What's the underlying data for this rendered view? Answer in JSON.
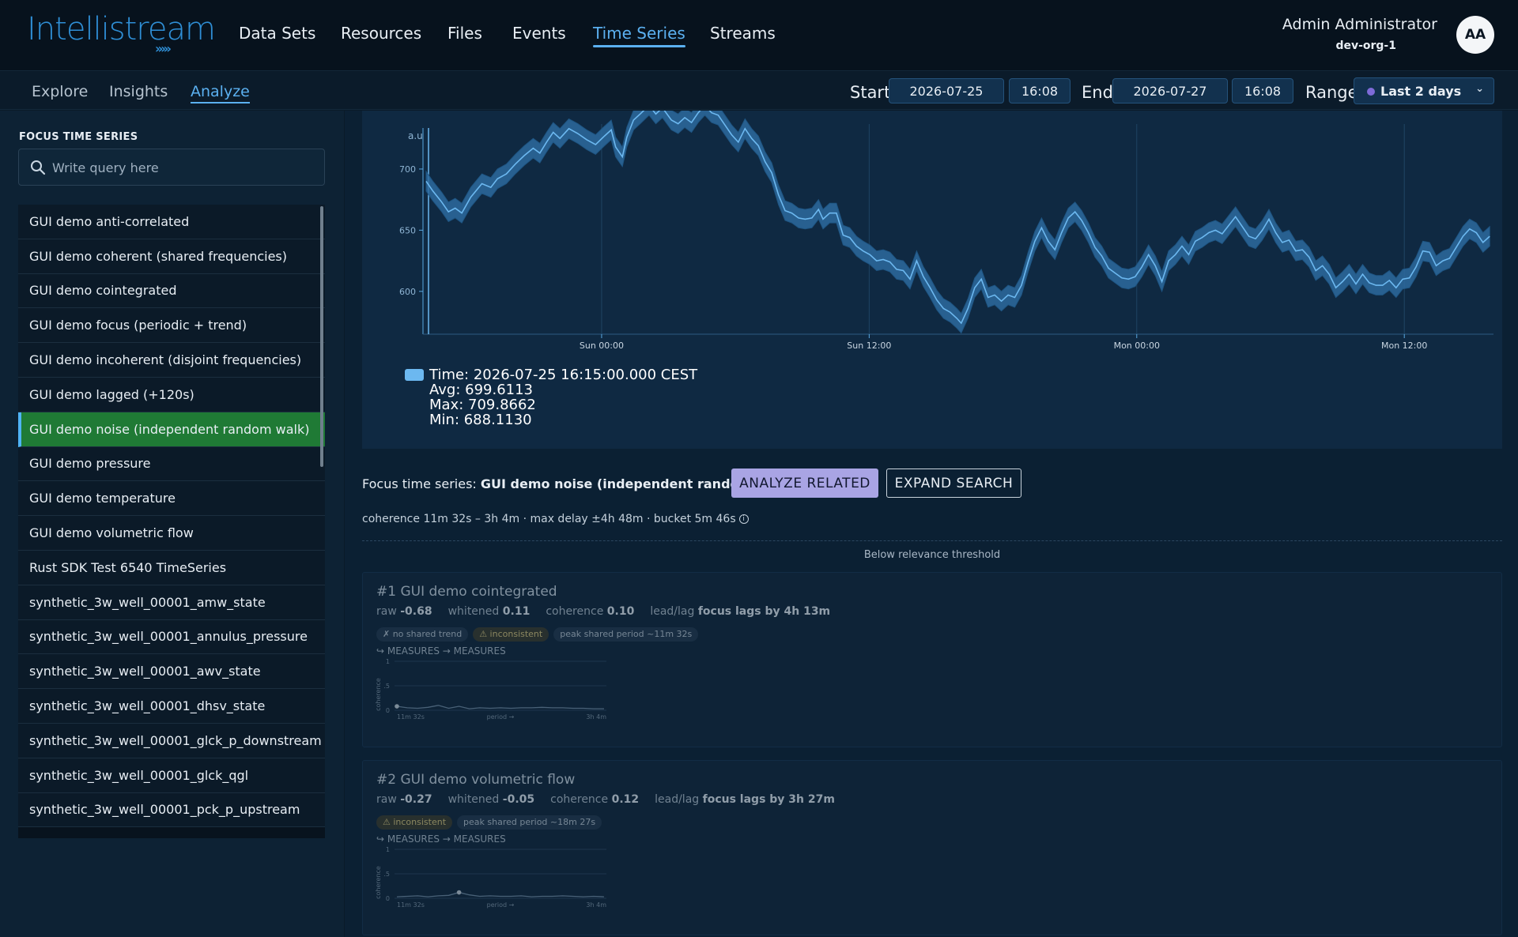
{
  "header": {
    "logo_text": "Intellistream",
    "nav": [
      {
        "label": "Data Sets",
        "active": false
      },
      {
        "label": "Resources",
        "active": false
      },
      {
        "label": "Files",
        "active": false
      },
      {
        "label": "Events",
        "active": false
      },
      {
        "label": "Time Series",
        "active": true
      },
      {
        "label": "Streams",
        "active": false
      }
    ],
    "user_name": "Admin Administrator",
    "user_org": "dev-org-1",
    "avatar_initials": "AA"
  },
  "subnav": {
    "tabs": [
      {
        "label": "Explore",
        "active": false
      },
      {
        "label": "Insights",
        "active": false
      },
      {
        "label": "Analyze",
        "active": true
      }
    ],
    "start_label": "Start",
    "start_date": "2026-07-25",
    "start_time": "16:08",
    "end_label": "End",
    "end_date": "2026-07-27",
    "end_time": "16:08",
    "range_label": "Range",
    "range_value": "Last 2 days"
  },
  "sidebar": {
    "title": "FOCUS TIME SERIES",
    "search_placeholder": "Write query here",
    "items": [
      "GUI demo anti-correlated",
      "GUI demo coherent (shared frequencies)",
      "GUI demo cointegrated",
      "GUI demo focus (periodic + trend)",
      "GUI demo incoherent (disjoint frequencies)",
      "GUI demo lagged (+120s)",
      "GUI demo noise (independent random walk)",
      "GUI demo pressure",
      "GUI demo temperature",
      "GUI demo volumetric flow",
      "Rust SDK Test 6540 TimeSeries",
      "synthetic_3w_well_00001_amw_state",
      "synthetic_3w_well_00001_annulus_pressure",
      "synthetic_3w_well_00001_awv_state",
      "synthetic_3w_well_00001_dhsv_state",
      "synthetic_3w_well_00001_glck_p_downstream",
      "synthetic_3w_well_00001_glck_qgl",
      "synthetic_3w_well_00001_pck_p_upstream"
    ],
    "selected_index": 6
  },
  "chart_data": {
    "type": "line",
    "ylabel": "a.u",
    "yticks": [
      600,
      650,
      700
    ],
    "ylim": [
      565,
      740
    ],
    "xlim": [
      0,
      47.87
    ],
    "xticks": [
      {
        "label": "Sun 00:00",
        "x": 7.87
      },
      {
        "label": "Sun 12:00",
        "x": 19.87
      },
      {
        "label": "Mon 00:00",
        "x": 31.87
      },
      {
        "label": "Mon 12:00",
        "x": 43.87
      }
    ],
    "band_halfwidth": 8,
    "series": [
      {
        "values": [
          [
            0.0,
            690
          ],
          [
            0.3,
            682
          ],
          [
            0.7,
            673
          ],
          [
            1.0,
            665
          ],
          [
            1.3,
            668
          ],
          [
            1.6,
            664
          ],
          [
            2.0,
            677
          ],
          [
            2.5,
            688
          ],
          [
            2.9,
            685
          ],
          [
            3.2,
            692
          ],
          [
            3.6,
            696
          ],
          [
            4.0,
            704
          ],
          [
            4.4,
            711
          ],
          [
            4.8,
            717
          ],
          [
            5.1,
            713
          ],
          [
            5.4,
            722
          ],
          [
            5.7,
            730
          ],
          [
            6.0,
            725
          ],
          [
            6.4,
            733
          ],
          [
            6.8,
            729
          ],
          [
            7.2,
            724
          ],
          [
            7.6,
            720
          ],
          [
            8.0,
            727
          ],
          [
            8.3,
            732
          ],
          [
            8.5,
            718
          ],
          [
            8.8,
            710
          ],
          [
            9.0,
            726
          ],
          [
            9.3,
            740
          ],
          [
            9.6,
            745
          ],
          [
            10.0,
            752
          ],
          [
            10.3,
            745
          ],
          [
            10.6,
            750
          ],
          [
            11.0,
            740
          ],
          [
            11.3,
            737
          ],
          [
            11.6,
            742
          ],
          [
            11.9,
            738
          ],
          [
            12.2,
            746
          ],
          [
            12.5,
            752
          ],
          [
            12.8,
            746
          ],
          [
            13.1,
            744
          ],
          [
            13.4,
            736
          ],
          [
            13.7,
            728
          ],
          [
            14.0,
            722
          ],
          [
            14.3,
            733
          ],
          [
            14.6,
            725
          ],
          [
            14.9,
            719
          ],
          [
            15.2,
            706
          ],
          [
            15.5,
            697
          ],
          [
            15.8,
            679
          ],
          [
            16.1,
            666
          ],
          [
            16.4,
            664
          ],
          [
            16.7,
            660
          ],
          [
            17.0,
            659
          ],
          [
            17.3,
            660
          ],
          [
            17.6,
            667
          ],
          [
            17.8,
            659
          ],
          [
            18.1,
            664
          ],
          [
            18.4,
            664
          ],
          [
            18.7,
            646
          ],
          [
            19.0,
            644
          ],
          [
            19.3,
            637
          ],
          [
            19.6,
            633
          ],
          [
            19.9,
            630
          ],
          [
            20.2,
            625
          ],
          [
            20.5,
            626
          ],
          [
            20.8,
            624
          ],
          [
            21.1,
            618
          ],
          [
            21.4,
            617
          ],
          [
            21.7,
            610
          ],
          [
            22.0,
            625
          ],
          [
            22.3,
            612
          ],
          [
            22.6,
            603
          ],
          [
            22.9,
            593
          ],
          [
            23.2,
            586
          ],
          [
            23.5,
            583
          ],
          [
            23.8,
            578
          ],
          [
            24.0,
            574
          ],
          [
            24.3,
            586
          ],
          [
            24.6,
            603
          ],
          [
            24.9,
            610
          ],
          [
            25.2,
            595
          ],
          [
            25.5,
            597
          ],
          [
            25.8,
            592
          ],
          [
            26.1,
            597
          ],
          [
            26.4,
            595
          ],
          [
            26.7,
            605
          ],
          [
            27.0,
            624
          ],
          [
            27.3,
            641
          ],
          [
            27.6,
            652
          ],
          [
            27.9,
            641
          ],
          [
            28.2,
            634
          ],
          [
            28.5,
            648
          ],
          [
            28.8,
            660
          ],
          [
            29.1,
            665
          ],
          [
            29.4,
            658
          ],
          [
            29.7,
            648
          ],
          [
            30.0,
            636
          ],
          [
            30.3,
            629
          ],
          [
            30.6,
            619
          ],
          [
            30.9,
            615
          ],
          [
            31.2,
            611
          ],
          [
            31.5,
            610
          ],
          [
            31.8,
            612
          ],
          [
            32.1,
            620
          ],
          [
            32.4,
            630
          ],
          [
            32.7,
            621
          ],
          [
            33.0,
            608
          ],
          [
            33.3,
            625
          ],
          [
            33.6,
            630
          ],
          [
            33.9,
            637
          ],
          [
            34.2,
            630
          ],
          [
            34.5,
            641
          ],
          [
            34.8,
            644
          ],
          [
            35.1,
            648
          ],
          [
            35.4,
            650
          ],
          [
            35.7,
            647
          ],
          [
            36.0,
            654
          ],
          [
            36.3,
            661
          ],
          [
            36.6,
            653
          ],
          [
            36.9,
            645
          ],
          [
            37.2,
            643
          ],
          [
            37.5,
            650
          ],
          [
            37.8,
            659
          ],
          [
            38.1,
            648
          ],
          [
            38.4,
            640
          ],
          [
            38.7,
            642
          ],
          [
            39.0,
            633
          ],
          [
            39.3,
            634
          ],
          [
            39.6,
            628
          ],
          [
            39.9,
            617
          ],
          [
            40.2,
            621
          ],
          [
            40.5,
            614
          ],
          [
            40.8,
            603
          ],
          [
            41.1,
            608
          ],
          [
            41.4,
            614
          ],
          [
            41.7,
            606
          ],
          [
            42.0,
            614
          ],
          [
            42.3,
            607
          ],
          [
            42.6,
            605
          ],
          [
            42.9,
            605
          ],
          [
            43.2,
            609
          ],
          [
            43.5,
            603
          ],
          [
            43.8,
            610
          ],
          [
            44.1,
            611
          ],
          [
            44.4,
            620
          ],
          [
            44.7,
            633
          ],
          [
            45.0,
            632
          ],
          [
            45.3,
            621
          ],
          [
            45.6,
            625
          ],
          [
            45.9,
            627
          ],
          [
            46.2,
            636
          ],
          [
            46.5,
            645
          ],
          [
            46.8,
            651
          ],
          [
            47.1,
            648
          ],
          [
            47.4,
            640
          ],
          [
            47.7,
            645
          ]
        ]
      }
    ],
    "tooltip": {
      "time": "Time: 2026-07-25 16:15:00.000 CEST",
      "avg": "Avg: 699.6113",
      "max": "Max: 709.8662",
      "min": "Min: 688.1130"
    }
  },
  "analysis": {
    "focus_prefix": "Focus time series:",
    "focus_name": "GUI demo noise (independent random walk)",
    "analyze_button": "ANALYZE RELATED",
    "expand_button": "EXPAND SEARCH",
    "params": "coherence 11m 32s – 3h 4m · max delay ±4h 48m · bucket 5m 46s",
    "below_threshold": "Below relevance threshold",
    "results": [
      {
        "title": "#1 GUI demo cointegrated",
        "raw_label": "raw",
        "raw": "-0.68",
        "whitened_label": "whitened",
        "whitened": "0.11",
        "coherence_label": "coherence",
        "coherence": "0.10",
        "leadlag_label": "lead/lag",
        "leadlag": "focus lags by 4h 13m",
        "badges": [
          {
            "text": "✗ no shared trend",
            "kind": "neutral"
          },
          {
            "text": "⚠ inconsistent",
            "kind": "warn"
          },
          {
            "text": "peak shared period ~11m 32s",
            "kind": "neutral"
          }
        ],
        "measures": "↪ MEASURES → MEASURES",
        "mini_chart": {
          "ylabel": "coherence",
          "yticks": [
            "1",
            ".5",
            "0"
          ],
          "xlabels": [
            "11m 32s",
            "period →",
            "3h 4m"
          ],
          "values": [
            0.08,
            0.05,
            0.04,
            0.06,
            0.1,
            0.04,
            0.08,
            0.03,
            0.05,
            0.04,
            0.05,
            0.04,
            0.05,
            0.05,
            0.06,
            0.05,
            0.05,
            0.04,
            0.04,
            0.03,
            0.03
          ],
          "peak_index": 0
        }
      },
      {
        "title": "#2 GUI demo volumetric flow",
        "raw_label": "raw",
        "raw": "-0.27",
        "whitened_label": "whitened",
        "whitened": "-0.05",
        "coherence_label": "coherence",
        "coherence": "0.12",
        "leadlag_label": "lead/lag",
        "leadlag": "focus lags by 3h 27m",
        "badges": [
          {
            "text": "⚠ inconsistent",
            "kind": "warn"
          },
          {
            "text": "peak shared period ~18m 27s",
            "kind": "neutral"
          }
        ],
        "measures": "↪ MEASURES → MEASURES",
        "mini_chart": {
          "ylabel": "coherence",
          "yticks": [
            "1",
            ".5",
            "0"
          ],
          "xlabels": [
            "11m 32s",
            "period →",
            "3h 4m"
          ],
          "values": [
            0.03,
            0.04,
            0.05,
            0.03,
            0.05,
            0.06,
            0.12,
            0.07,
            0.04,
            0.05,
            0.04,
            0.04,
            0.05,
            0.03,
            0.04,
            0.04,
            0.05,
            0.04,
            0.03,
            0.04,
            0.03
          ],
          "peak_index": 6
        }
      }
    ]
  },
  "colors": {
    "accent": "#5bb0f0",
    "selected_row": "#1f7a35",
    "analyze_button": "#a9a4e4",
    "series_line": "#5aa9e2",
    "series_band": "#2d6a9e"
  }
}
